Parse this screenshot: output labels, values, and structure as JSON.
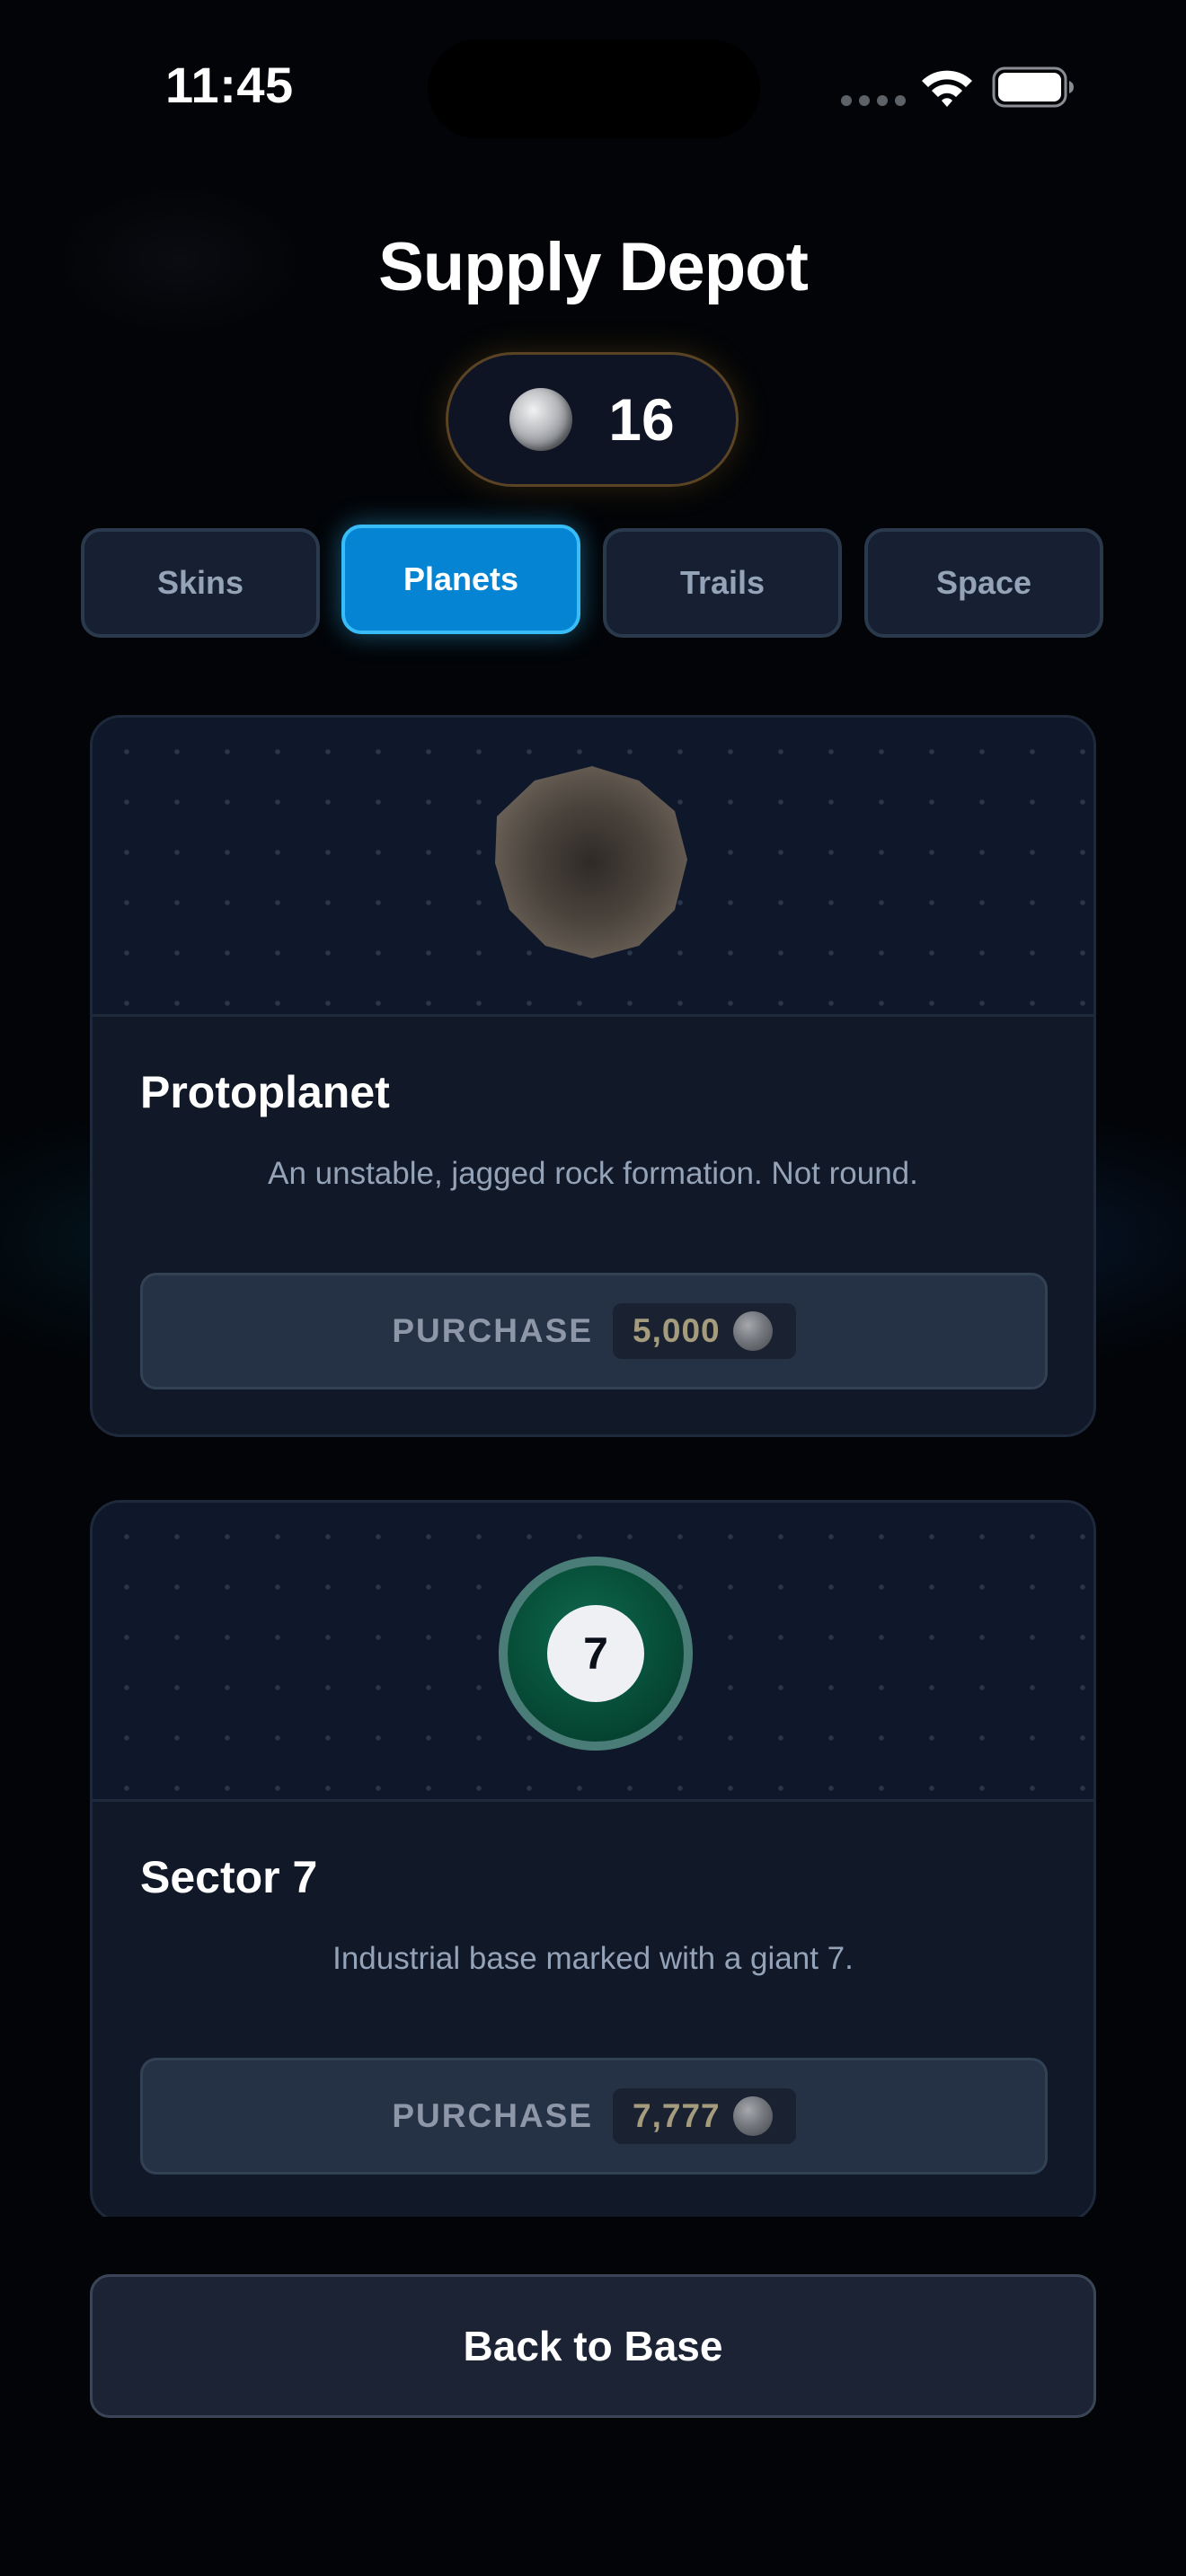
{
  "status_bar": {
    "time": "11:45"
  },
  "header": {
    "title": "Supply Depot"
  },
  "balance": {
    "value": "16",
    "icon": "coin-icon"
  },
  "tabs": [
    {
      "label": "Skins",
      "active": false
    },
    {
      "label": "Planets",
      "active": true
    },
    {
      "label": "Trails",
      "active": false
    },
    {
      "label": "Space",
      "active": false
    }
  ],
  "items": [
    {
      "name": "Protoplanet",
      "description": "An unstable, jagged rock formation. Not round.",
      "purchase_label": "PURCHASE",
      "price": "5,000",
      "icon": "protoplanet-icon"
    },
    {
      "name": "Sector 7",
      "description": "Industrial base marked with a giant 7.",
      "purchase_label": "PURCHASE",
      "price": "7,777",
      "icon": "sector7-planet-icon",
      "badge": "7"
    }
  ],
  "footer": {
    "back_label": "Back to Base"
  },
  "colors": {
    "accent": "#0484d2",
    "accent_border": "#38bdf8",
    "background": "#020407",
    "card": "#111827",
    "price_text": "#a49c7d"
  }
}
